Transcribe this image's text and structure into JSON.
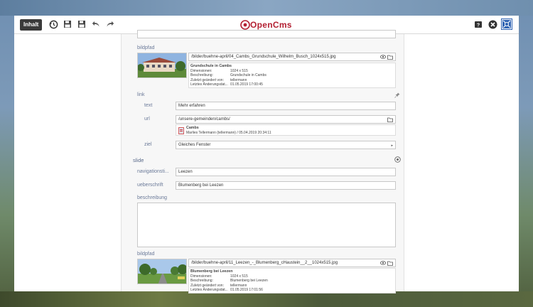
{
  "toolbar": {
    "inhalt_label": "Inhalt",
    "logo_text": "OpenCms"
  },
  "editor": {
    "bildpfad1": {
      "label": "bildpfad",
      "path": "/bilder/buehne-april/04_Cambs_Grundschule_Wilhelm_Busch_1024x515.jpg",
      "title": "Grundschule in Cambs",
      "rows": [
        {
          "k": "Dimensionen:",
          "v": "1024 x 515"
        },
        {
          "k": "Beschreibung:",
          "v": "Grundschule in Cambs"
        },
        {
          "k": "Zuletzt geändert von:",
          "v": "tellermann"
        },
        {
          "k": "Letztes Änderungsdat...",
          "v": "01.05.2019 17:00:45"
        }
      ]
    },
    "link": {
      "label": "link",
      "text_label": "text",
      "text_value": "Mehr erfahren",
      "url_label": "url",
      "url_value": "/unsere-gemeinden/cambs/",
      "url_title": "Cambs",
      "url_sub": "Marlies Tellermann (tellermann) / 05.04.2019 20:34:11",
      "ziel_label": "ziel",
      "ziel_value": "Gleiches Fenster"
    },
    "slide": {
      "label": "slide",
      "nav_label": "navigationsti...",
      "nav_value": "Leezen",
      "ueber_label": "ueberschrift",
      "ueber_value": "Blumenberg bei Leezen",
      "beschreibung_label": "beschreibung",
      "bildpfad_label": "bildpfad",
      "path": "/bilder/buehne-april/11_Leezen_-_Blumenberg_cHaustein__2__1024x515.jpg",
      "title": "Blumenberg bei Leezen",
      "rows": [
        {
          "k": "Dimensionen:",
          "v": "1024 x 515"
        },
        {
          "k": "Beschreibung:",
          "v": "Blumenberg bei Leezen"
        },
        {
          "k": "Zuletzt geändert von:",
          "v": "tellermann"
        },
        {
          "k": "Letztes Änderungsdat...",
          "v": "01.05.2019 17:01:56"
        }
      ]
    }
  },
  "colors": {
    "accent": "#b32032",
    "label": "#6b7a99",
    "toolbar_button": "#3a3a3a"
  }
}
